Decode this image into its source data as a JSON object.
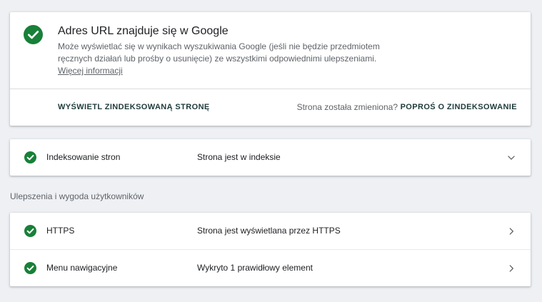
{
  "status_card": {
    "icon": "check-circle-icon",
    "title": "Adres URL znajduje się w Google",
    "description": "Może wyświetlać się w wynikach wyszukiwania Google (jeśli nie będzie przedmiotem ręcznych działań lub prośby o usunięcie) ze wszystkimi odpowiednimi ulepszeniami.",
    "more_link": "Więcej informacji",
    "view_indexed_button": "WYŚWIETL ZINDEKSOWANĄ STRONĘ",
    "page_changed_text": "Strona została zmieniona?",
    "request_indexing_button": "POPROŚ O ZINDEKSOWANIE"
  },
  "indexing": {
    "label": "Indeksowanie stron",
    "value": "Strona jest w indeksie",
    "icon": "chevron-down-icon"
  },
  "enhancements": {
    "section_title": "Ulepszenia i wygoda użytkowników",
    "items": [
      {
        "label": "HTTPS",
        "value": "Strona jest wyświetlana przez HTTPS",
        "icon": "chevron-right-icon"
      },
      {
        "label": "Menu nawigacyjne",
        "value": "Wykryto 1 prawidłowy element",
        "icon": "chevron-right-icon"
      }
    ]
  },
  "colors": {
    "success_green": "#188038",
    "background": "#eef0f4",
    "card": "#ffffff"
  }
}
